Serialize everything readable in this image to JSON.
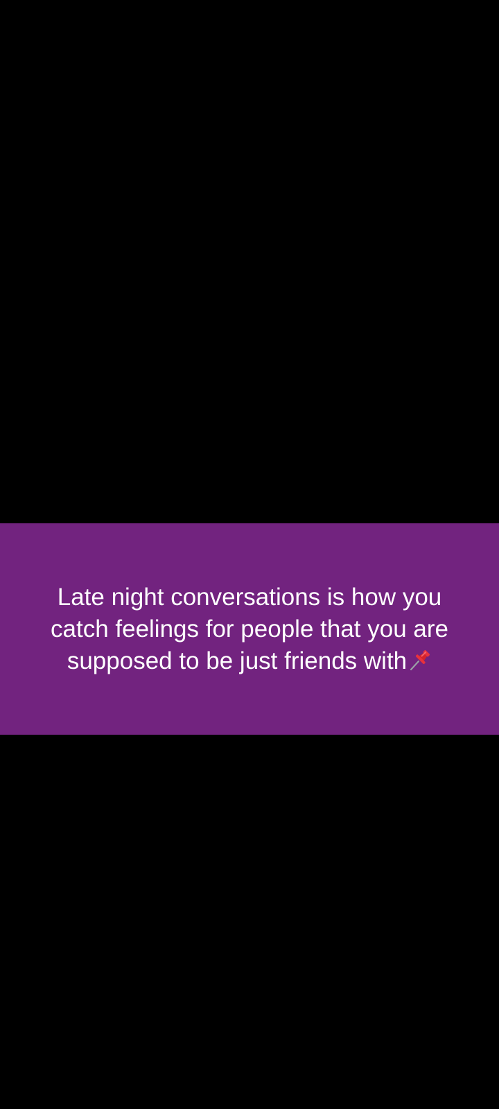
{
  "background_color": "#000000",
  "banner": {
    "background_color": "#72237f",
    "text_color": "#ffffff",
    "lines": [
      "Late night conversations is how you",
      "catch feelings for people that you are",
      "supposed to be just friends with"
    ],
    "trailing_icon": "pushpin-icon"
  }
}
